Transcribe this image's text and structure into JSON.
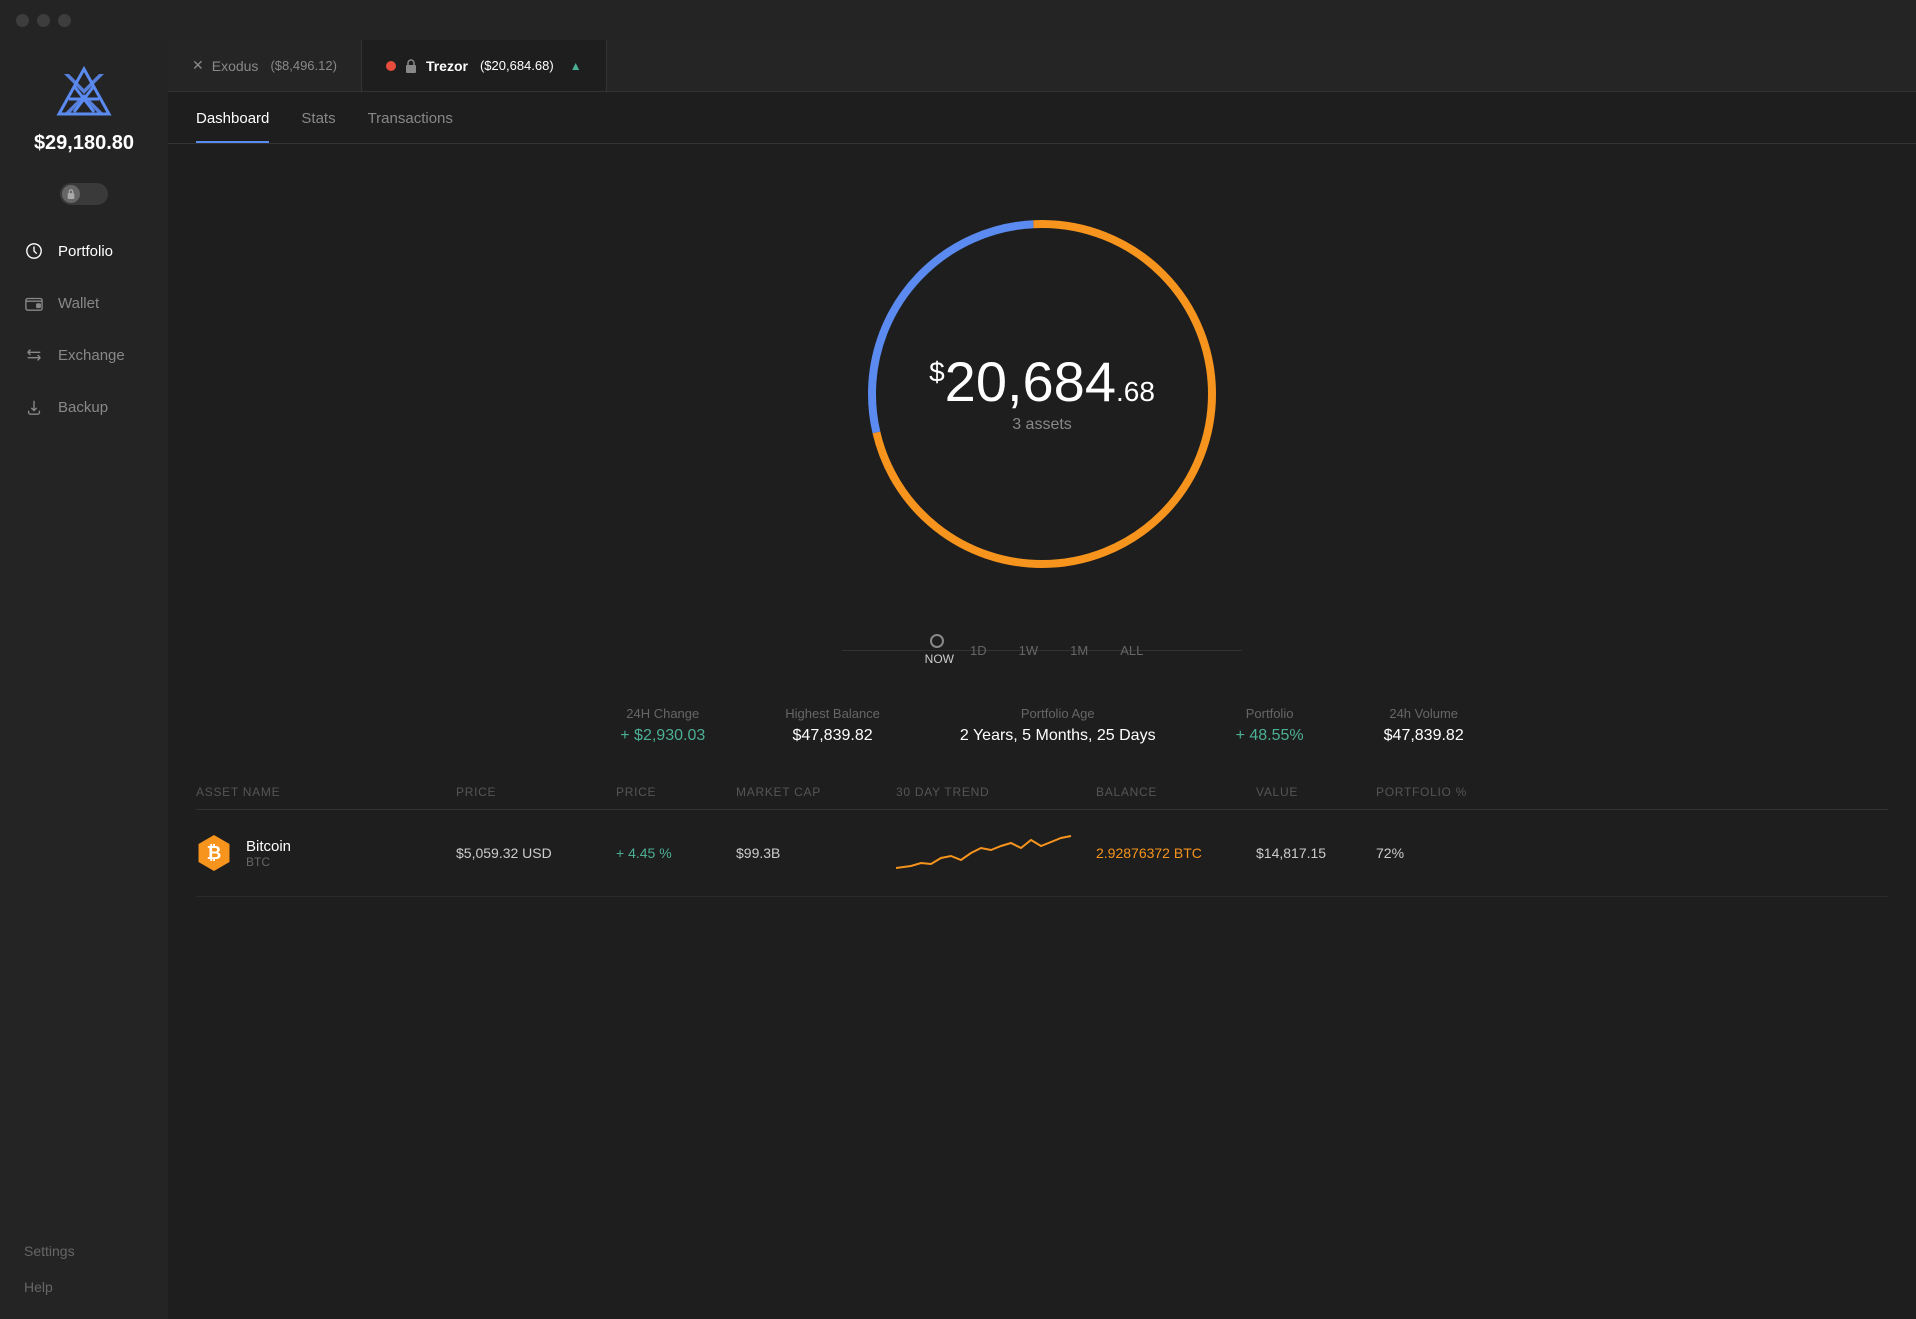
{
  "titlebar": {
    "lights": [
      "close",
      "minimize",
      "maximize"
    ]
  },
  "sidebar": {
    "balance": "$29,180.80",
    "nav": [
      {
        "id": "portfolio",
        "label": "Portfolio",
        "icon": "clock",
        "active": true
      },
      {
        "id": "wallet",
        "label": "Wallet",
        "icon": "wallet",
        "active": false
      },
      {
        "id": "exchange",
        "label": "Exchange",
        "icon": "exchange",
        "active": false
      },
      {
        "id": "backup",
        "label": "Backup",
        "icon": "backup",
        "active": false
      }
    ],
    "bottom": [
      {
        "id": "settings",
        "label": "Settings"
      },
      {
        "id": "help",
        "label": "Help"
      }
    ]
  },
  "wallet_tabs": [
    {
      "id": "exodus",
      "label": "Exodus",
      "amount": "($8,496.12)",
      "active": false,
      "dot": false
    },
    {
      "id": "trezor",
      "label": "Trezor",
      "amount": "($20,684.68)",
      "active": true,
      "dot": true,
      "arrow": "▲"
    }
  ],
  "dashboard_tabs": [
    {
      "id": "dashboard",
      "label": "Dashboard",
      "active": true
    },
    {
      "id": "stats",
      "label": "Stats",
      "active": false
    },
    {
      "id": "transactions",
      "label": "Transactions",
      "active": false
    }
  ],
  "chart": {
    "amount_dollar": "$",
    "amount_main": "20,684",
    "amount_cents": ".68",
    "assets_label": "3 assets",
    "blue_pct": 28,
    "gold_pct": 72
  },
  "time_range": {
    "buttons": [
      "NOW",
      "1D",
      "1W",
      "1M",
      "ALL"
    ],
    "active": "NOW"
  },
  "stats": [
    {
      "label": "24H Change",
      "value": "+ $2,930.03",
      "positive": true
    },
    {
      "label": "Highest Balance",
      "value": "$47,839.82",
      "positive": false
    },
    {
      "label": "Portfolio Age",
      "value": "2 Years, 5 Months, 25 Days",
      "positive": false
    },
    {
      "label": "Portfolio",
      "value": "+ 48.55%",
      "positive": true
    },
    {
      "label": "24h Volume",
      "value": "$47,839.82",
      "positive": false
    }
  ],
  "asset_table": {
    "headers": [
      "ASSET NAME",
      "PRICE",
      "PRICE",
      "MARKET CAP",
      "30 DAY TREND",
      "BALANCE",
      "VALUE",
      "PORTFOLIO %"
    ],
    "rows": [
      {
        "name": "Bitcoin",
        "ticker": "BTC",
        "icon": "₿",
        "icon_bg": "#f7941d",
        "price_usd": "$5,059.32 USD",
        "price_change": "+ 4.45 %",
        "market_cap": "$99.3B",
        "balance": "2.92876372 BTC",
        "value": "$14,817.15",
        "portfolio_pct": "72%"
      }
    ]
  },
  "colors": {
    "accent_blue": "#5b8af0",
    "accent_gold": "#f7941d",
    "positive": "#4caf94",
    "negative": "#e74c3c",
    "sidebar_bg": "#242424",
    "main_bg": "#1e1e1e"
  }
}
